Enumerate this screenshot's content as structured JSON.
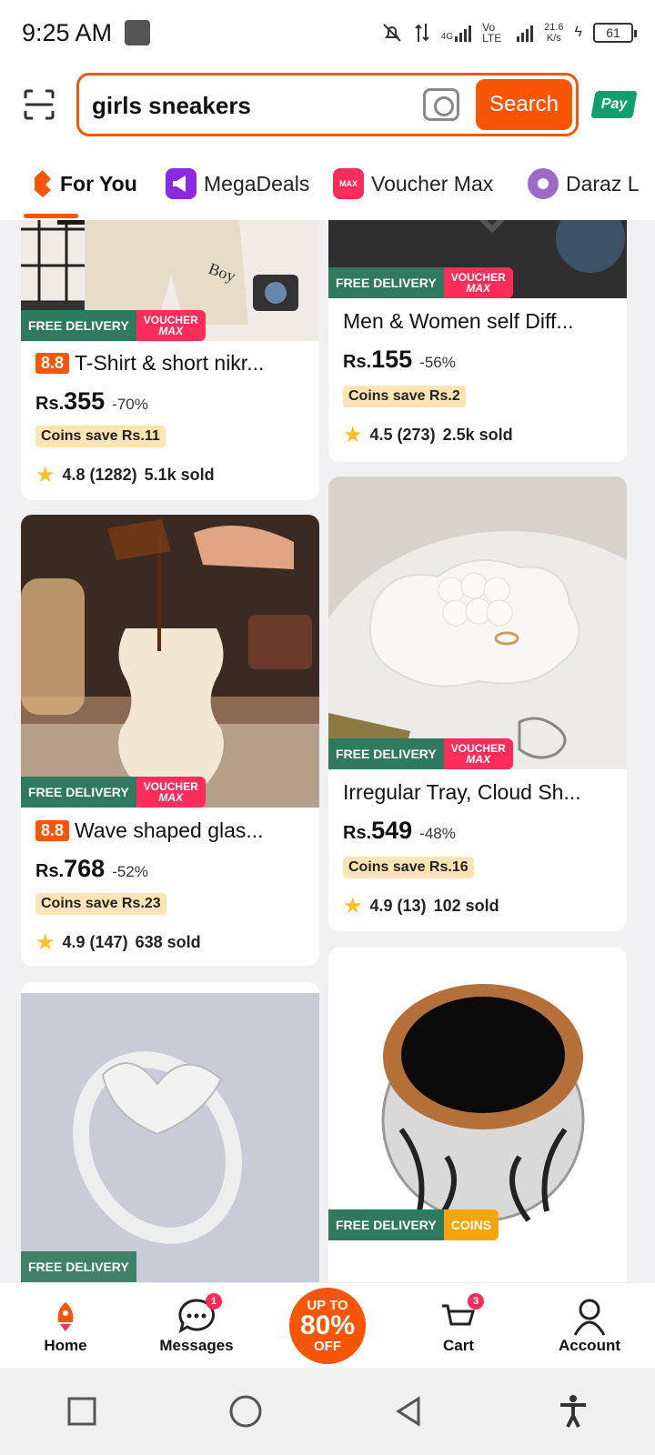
{
  "status": {
    "time": "9:25 AM",
    "network1": "4G",
    "network2": "Vo LTE",
    "speed_value": "21.6",
    "speed_unit": "K/s",
    "battery": "61"
  },
  "search": {
    "query": "girls sneakers",
    "button_label": "Search",
    "pay_label": "Pay"
  },
  "tabs": [
    {
      "label": "For You"
    },
    {
      "label": "MegaDeals"
    },
    {
      "label": "Voucher Max"
    },
    {
      "label": "Daraz L"
    }
  ],
  "tab_icon_text": {
    "voucher": "MAX"
  },
  "badges": {
    "free_delivery": "FREE DELIVERY",
    "voucher_line1": "VOUCHER",
    "voucher_line2": "MAX",
    "coins": "COINS",
    "sale_88": "8.8"
  },
  "products": [
    {
      "title": "T-Shirt & short nikr...",
      "has_88": true,
      "currency": "Rs.",
      "price": "355",
      "discount": "-70%",
      "coins_save": "Coins save Rs.11",
      "rating": "4.8 (1282)",
      "sold": "5.1k sold"
    },
    {
      "title": "Men & Women self Diff...",
      "has_88": false,
      "currency": "Rs.",
      "price": "155",
      "discount": "-56%",
      "coins_save": "Coins save Rs.2",
      "rating": "4.5 (273)",
      "sold": "2.5k sold"
    },
    {
      "title": "Wave shaped glas...",
      "has_88": true,
      "currency": "Rs.",
      "price": "768",
      "discount": "-52%",
      "coins_save": "Coins save Rs.23",
      "rating": "4.9 (147)",
      "sold": "638 sold"
    },
    {
      "title": "Irregular Tray, Cloud Sh...",
      "has_88": false,
      "currency": "Rs.",
      "price": "549",
      "discount": "-48%",
      "coins_save": "Coins save Rs.16",
      "rating": "4.9 (13)",
      "sold": "102 sold"
    }
  ],
  "bottom_nav": {
    "home": "Home",
    "messages": "Messages",
    "messages_count": "1",
    "promo_line1": "UP TO",
    "promo_line2": "80%",
    "promo_line3": "OFF",
    "cart": "Cart",
    "cart_count": "3",
    "account": "Account"
  },
  "colors": {
    "brand": "#f85606",
    "free_delivery": "#2f7a5e",
    "voucher": "#fc2d5a",
    "coins": "#f5a50b"
  }
}
